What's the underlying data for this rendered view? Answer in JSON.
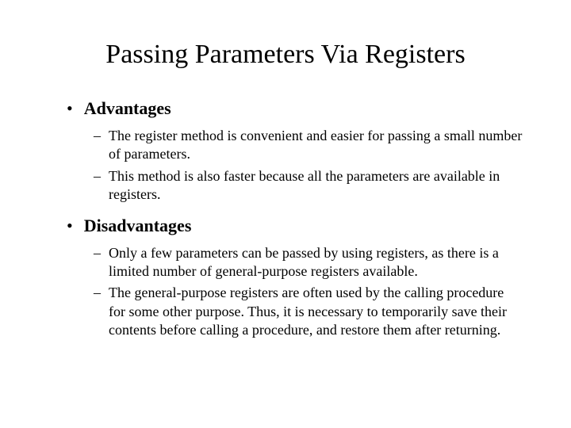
{
  "title": "Passing Parameters Via Registers",
  "sections": [
    {
      "heading": "Advantages",
      "items": [
        "The register method is convenient and easier for passing a small number of parameters.",
        "This method is also faster because all the parameters are available in registers."
      ]
    },
    {
      "heading": "Disadvantages",
      "items": [
        "Only a few parameters can be passed by using registers, as there is a limited number of general-purpose registers available.",
        "The general-purpose registers are often used by the calling procedure for some other purpose. Thus, it is necessary to temporarily save their contents before calling a procedure, and restore them after returning."
      ]
    }
  ]
}
